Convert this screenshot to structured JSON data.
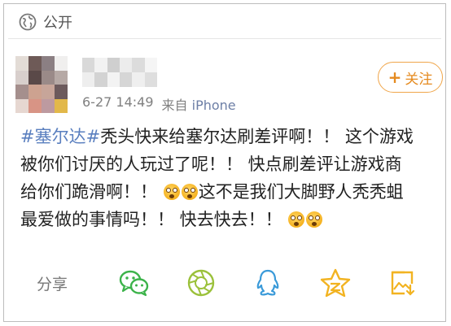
{
  "header": {
    "visibility_icon": "globe-icon",
    "visibility_label": "公开"
  },
  "post": {
    "author_blurred": true,
    "date": "6-27 14:49",
    "source_prefix": "来自",
    "source_app": "iPhone",
    "follow_label": "关注",
    "lines": [
      {
        "tag": "#塞尔达#",
        "text": "秃头快来给塞尔达刷差评啊！！ 这个游戏"
      },
      {
        "text": "被你们讨厌的人玩过了呢！！ 快点刷差评让游戏商"
      },
      {
        "text_a": "给你们跪滑啊！！ ",
        "text_b": "这不是我们大脚野人秃秃蛆"
      },
      {
        "text_a": "最爱做的事情吗！！ 快去快去！！ "
      }
    ]
  },
  "actions": {
    "share_label": "分享",
    "buttons": [
      "wechat-icon",
      "moments-icon",
      "qq-icon",
      "qzone-star-icon",
      "save-image-icon"
    ]
  },
  "colors": {
    "accent_orange": "#e58a1f",
    "link_blue": "#5a7fbf",
    "wechat_green": "#3cb34a",
    "moments_green": "#9bc13b",
    "qq_blue": "#3a9ad9",
    "star_yellow": "#f2b321"
  }
}
